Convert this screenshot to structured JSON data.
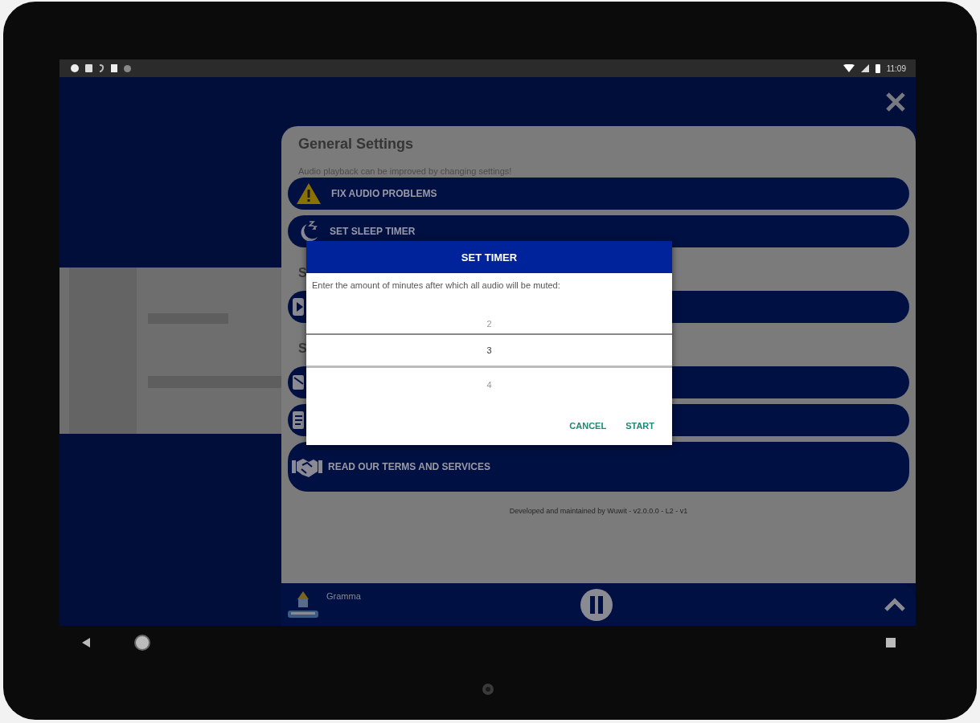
{
  "status_bar": {
    "time": "11:09"
  },
  "panel": {
    "title": "General Settings",
    "subtitle": "Audio playback can be improved by changing settings!",
    "items": [
      {
        "kind": "button",
        "label": "FIX AUDIO PROBLEMS"
      },
      {
        "kind": "button",
        "label": "SET SLEEP TIMER"
      },
      {
        "kind": "header",
        "label": "S"
      },
      {
        "kind": "button"
      },
      {
        "kind": "header",
        "label": "S"
      },
      {
        "kind": "button"
      },
      {
        "kind": "button"
      },
      {
        "kind": "large-button",
        "label": "READ OUR TERMS AND SERVICES"
      }
    ],
    "footer": "Developed and maintained by Wuwit - v2.0.0.0 - L2 - v1"
  },
  "mini_player": {
    "title": "Gramma"
  },
  "dialog": {
    "title": "SET TIMER",
    "message": "Enter the amount of minutes after which all audio will be muted:",
    "picker": [
      {
        "value": "2",
        "selected": false
      },
      {
        "value": "3",
        "selected": true
      },
      {
        "value": "4",
        "selected": false
      }
    ],
    "buttons": [
      "CANCEL",
      "START"
    ]
  }
}
